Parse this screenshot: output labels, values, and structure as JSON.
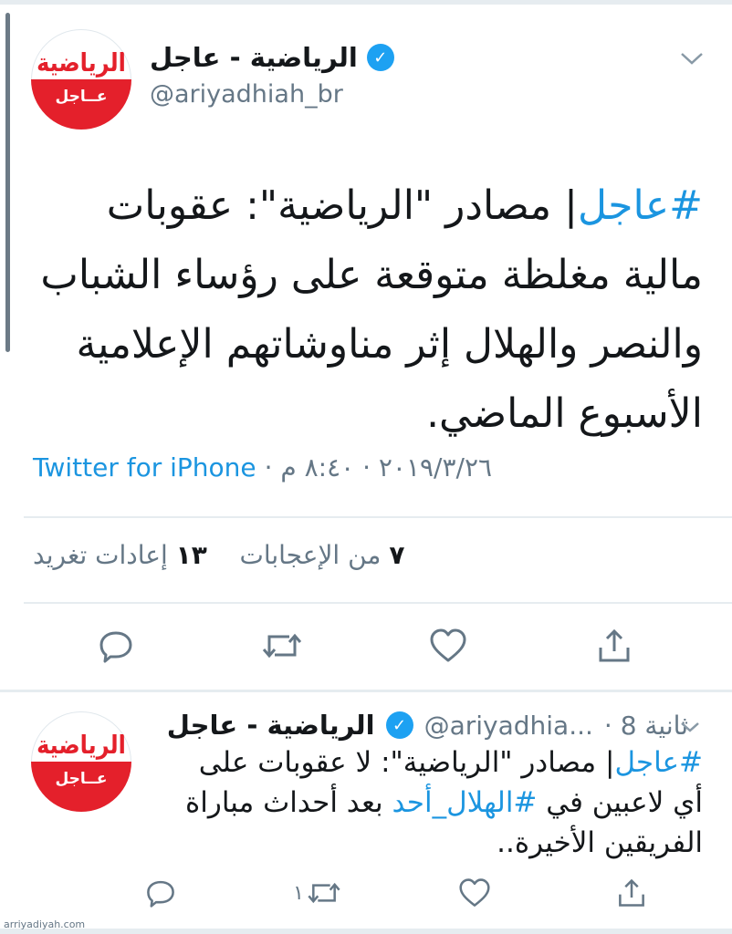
{
  "tweet": {
    "name": "الرياضية - عاجل",
    "handle": "@ariyadhiah_br",
    "avatar_brand": "الرياضية",
    "avatar_tag": "عــاجل",
    "hashtag": "#عاجل",
    "text": "| مصادر \"الرياضية\": عقوبات مالية مغلظة متوقعة على رؤساء الشباب والنصر والهلال إثر مناوشاتهم الإعلامية الأسبوع الماضي.",
    "source": "Twitter for iPhone",
    "timestamp": " · ٢٠١٩/٣/٢٦ · ٨:٤٠ م",
    "likes_count": "٧",
    "likes_label": "من الإعجابات",
    "retweets_count": "١٣",
    "retweets_label": "إعادات تغريد"
  },
  "reply": {
    "name": "الرياضية - عاجل",
    "handle": "@ariyadhia...",
    "time_ago": "· 8 ثانية",
    "avatar_brand": "الرياضية",
    "avatar_tag": "عــاجل",
    "hashtag1": "#عاجل",
    "text1": "| مصادر \"الرياضية\": لا عقوبات على أي لاعبين في ",
    "hashtag2": "#الهلال_أحد",
    "text2": " بعد أحداث مباراة الفريقين الأخيرة..",
    "retweet_count": "١"
  },
  "watermark": "arriyadiyah.com",
  "colors": {
    "accent": "#1b95e0",
    "brand_red": "#e4202b",
    "muted": "#657786"
  },
  "icons": [
    "chevron-down-icon",
    "verified-icon",
    "reply-icon",
    "retweet-icon",
    "like-icon",
    "share-icon"
  ]
}
